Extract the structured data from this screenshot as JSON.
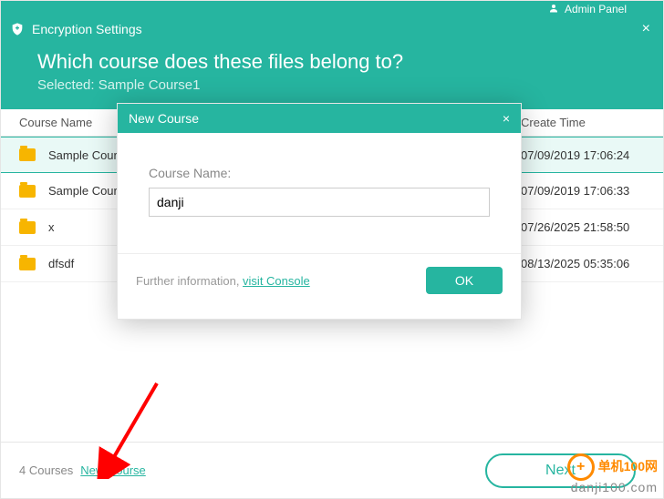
{
  "chrome": {
    "admin_label": "Admin Panel"
  },
  "title_bar": {
    "title": "Encryption Settings"
  },
  "header": {
    "question": "Which course does these files belong to?",
    "selected_label": "Selected: Sample Course1"
  },
  "table": {
    "columns": {
      "name": "Course Name",
      "create": "Create Time"
    },
    "rows": [
      {
        "name": "Sample Course1",
        "create": "07/09/2019 17:06:24",
        "selected": true
      },
      {
        "name": "Sample Course2",
        "create": "07/09/2019 17:06:33",
        "selected": false
      },
      {
        "name": "x",
        "create": "07/26/2025 21:58:50",
        "selected": false
      },
      {
        "name": "dfsdf",
        "create": "08/13/2025 05:35:06",
        "selected": false
      }
    ]
  },
  "footer": {
    "count": "4 Courses",
    "new_course": "New Course",
    "next": "Next"
  },
  "modal": {
    "title": "New Course",
    "input_label": "Course Name:",
    "input_value": "danji",
    "further": "Further information, ",
    "console_link": "visit Console",
    "ok": "OK"
  },
  "watermark": {
    "line1": "单机100网",
    "line2": "danji100.com"
  }
}
